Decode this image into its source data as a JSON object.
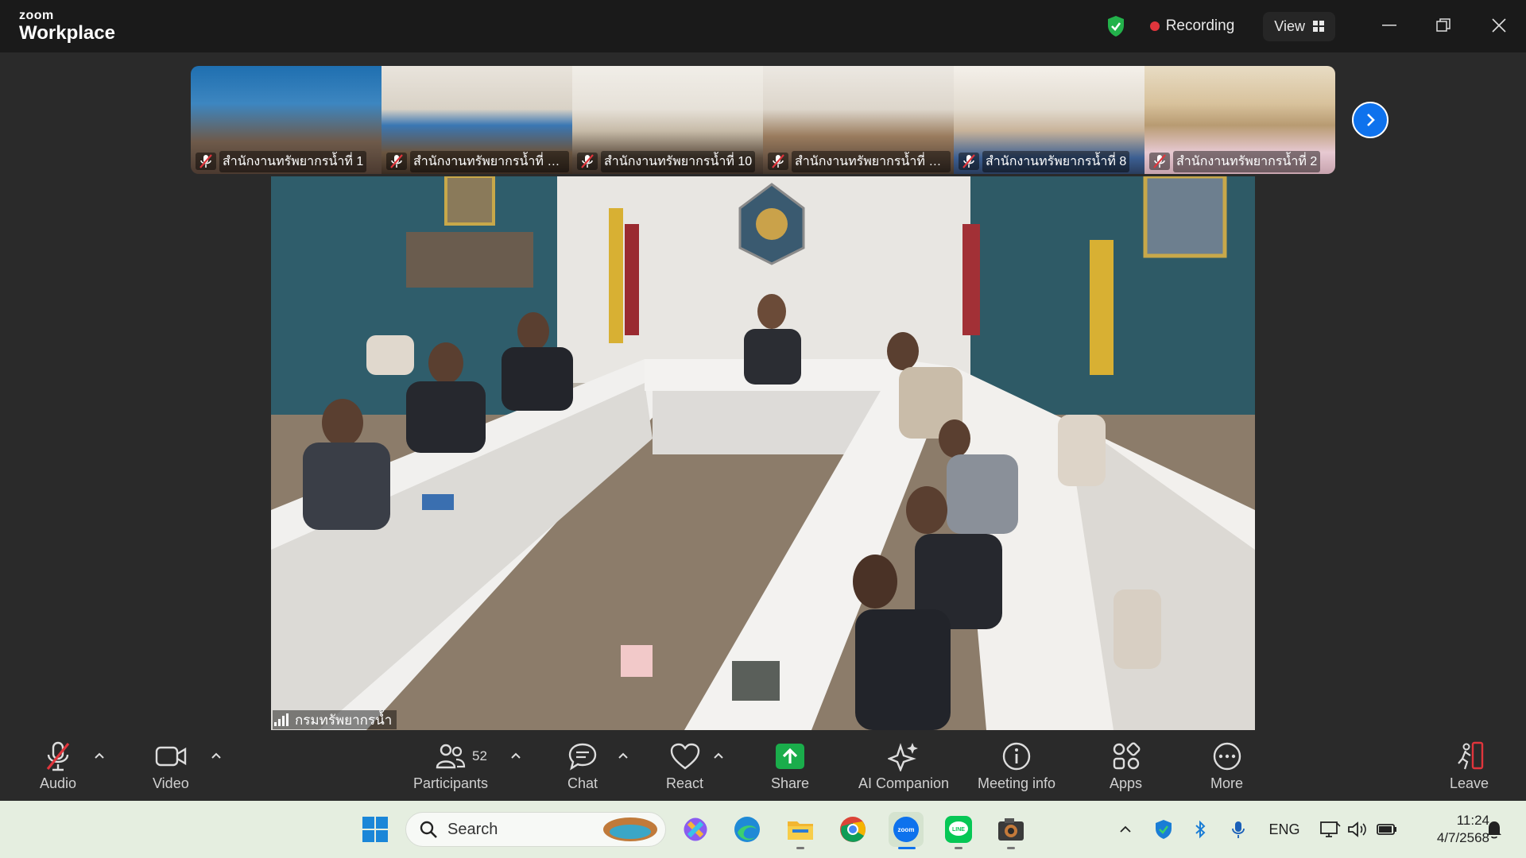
{
  "app": {
    "brand_small": "zoom",
    "brand_name": "Workplace"
  },
  "header": {
    "recording_label": "Recording",
    "view_label": "View"
  },
  "thumbnails": [
    {
      "name": "สำนักงานทรัพยากรน้ำที่ 1"
    },
    {
      "name": "สำนักงานทรัพยากรน้ำที่ 11 อ..."
    },
    {
      "name": "สำนักงานทรัพยากรน้ำที่ 10"
    },
    {
      "name": "สำนักงานทรัพยากรน้ำที่ 9 ..."
    },
    {
      "name": "สำนักงานทรัพยากรน้ำที่ 8"
    },
    {
      "name": "สำนักงานทรัพยากรน้ำที่ 2"
    }
  ],
  "main_video": {
    "participant_name": "กรมทรัพยากรน้ำ"
  },
  "toolbar": {
    "audio": "Audio",
    "video": "Video",
    "participants": "Participants",
    "participant_count": "52",
    "chat": "Chat",
    "react": "React",
    "share": "Share",
    "ai_companion": "AI Companion",
    "meeting_info": "Meeting info",
    "apps": "Apps",
    "more": "More",
    "leave": "Leave"
  },
  "taskbar": {
    "search_placeholder": "Search",
    "language": "ENG",
    "time": "11:24",
    "date": "4/7/2568"
  },
  "colors": {
    "accent": "#0e72ed",
    "recording": "#e0353c",
    "share": "#1aad4b",
    "muted": "#e0353c"
  }
}
